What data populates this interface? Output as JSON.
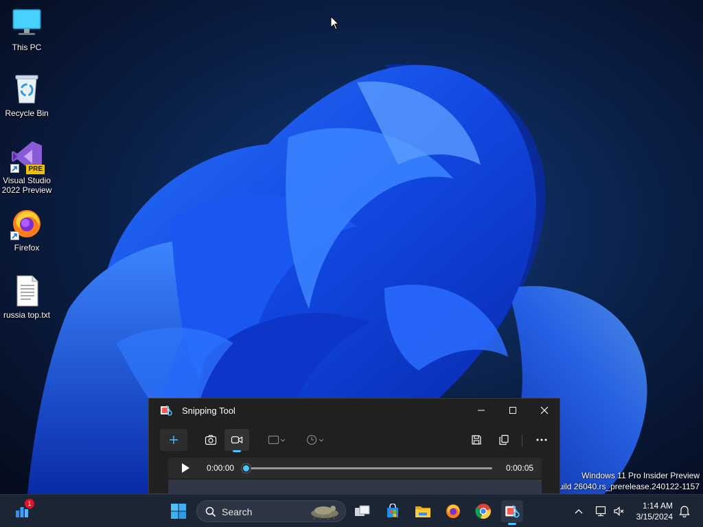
{
  "desktop": {
    "icons": [
      {
        "label": "This PC"
      },
      {
        "label": "Recycle Bin"
      },
      {
        "label_line1": "Visual Studio",
        "label_line2": "2022 Preview",
        "badge": "PRE"
      },
      {
        "label": "Firefox"
      },
      {
        "label": "russia top.txt"
      }
    ],
    "watermark": {
      "line1": "Windows 11 Pro Insider Preview",
      "line2": ". Build 26040.rs_prerelease.240122-1157"
    }
  },
  "snipping_tool": {
    "title": "Snipping Tool",
    "icons": {
      "new": "plus-icon",
      "screenshot_mode": "camera-icon",
      "record_mode": "video-camera-icon",
      "snip_shape": "rectangle-icon",
      "delay": "clock-icon",
      "save": "save-icon",
      "copy": "copy-icon",
      "more": "more-icon"
    },
    "player": {
      "current_time": "0:00:00",
      "total_time": "0:00:05",
      "progress": 0
    }
  },
  "taskbar": {
    "search_label": "Search",
    "widgets_badge": "1",
    "clock_time": "1:14 AM",
    "clock_date": "3/15/2024"
  },
  "colors": {
    "accent": "#4cc2ff",
    "window_bg": "#202020",
    "taskbar_bg": "#1c2533"
  }
}
